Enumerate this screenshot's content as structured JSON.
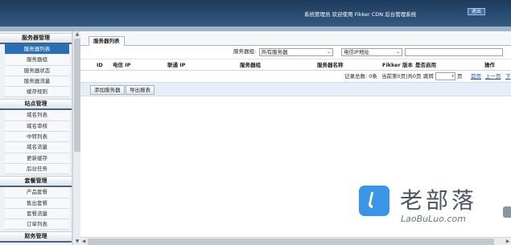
{
  "header": {
    "welcome": "系统管理员 欢迎使用 Fikker CDN 后台管理系统",
    "logout_label": "退出"
  },
  "sidebar": {
    "groups": [
      {
        "title": "服务器管理",
        "items": [
          "服务器列表",
          "服务器组",
          "服务器状态",
          "服务器流量",
          "缓存规则"
        ]
      },
      {
        "title": "站点管理",
        "items": [
          "域名列表",
          "域名审核",
          "中转列表",
          "域名流量",
          "更新缓存",
          "后台任务"
        ]
      },
      {
        "title": "套餐管理",
        "items": [
          "产品套餐",
          "售出套餐",
          "套餐流量",
          "订单列表"
        ]
      },
      {
        "title": "财务管理",
        "items": []
      }
    ]
  },
  "tab": {
    "label": "服务器列表"
  },
  "filter": {
    "group_label": "服务器组:",
    "group_value": "所有服务器",
    "field_value": "电信IP地址",
    "search_value": ""
  },
  "table": {
    "columns": [
      "ID",
      "电信 IP",
      "联通 IP",
      "服务器组",
      "服务器名称",
      "Fikker 版本",
      "是否启用",
      "操作"
    ],
    "rows": []
  },
  "pager": {
    "total": "记录总数: 0条",
    "current": "当前第0页|共0页",
    "jump_label": "跳转",
    "page_suffix": "页",
    "first": "首页",
    "prev": "上一页",
    "next": "下"
  },
  "actions": {
    "add_server": "添加服务器",
    "export": "导出报表"
  },
  "watermark": {
    "title": "老部落",
    "url": "LaoBuLuo.com"
  },
  "colors": {
    "header_bg": "#2b4e74",
    "active_nav": "#2a6eb5",
    "watermark_logo": "#3b95e6"
  }
}
